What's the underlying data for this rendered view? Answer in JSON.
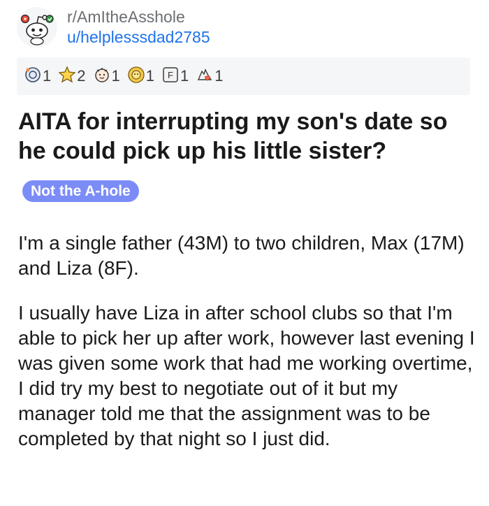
{
  "post": {
    "subreddit": "r/AmItheAsshole",
    "username": "u/helplesssdad2785",
    "awards": [
      {
        "icon": "helpful-award-icon",
        "count": "1"
      },
      {
        "icon": "gold-star-award-icon",
        "count": "2"
      },
      {
        "icon": "wholesome-award-icon",
        "count": "1"
      },
      {
        "icon": "sun-award-icon",
        "count": "1"
      },
      {
        "icon": "press-f-award-icon",
        "count": "1"
      },
      {
        "icon": "hands-heart-award-icon",
        "count": "1"
      }
    ],
    "title": "AITA for interrupting my son's date so he could pick up his little sister?",
    "flair": "Not the A-hole",
    "paragraphs": [
      "I'm a single father (43M) to two children, Max (17M) and Liza (8F).",
      "I usually have Liza in after school clubs so that I'm able to pick her up after work, however last evening I was given some work that had me working overtime, I did try my best to negotiate out of it but my manager told me that the assignment was to be completed by that night so I just did."
    ]
  },
  "colors": {
    "flair_background": "#7c8cf7",
    "username": "#1e73e8",
    "subreddit": "#6b6e72",
    "awards_bar": "#f5f6f7"
  }
}
